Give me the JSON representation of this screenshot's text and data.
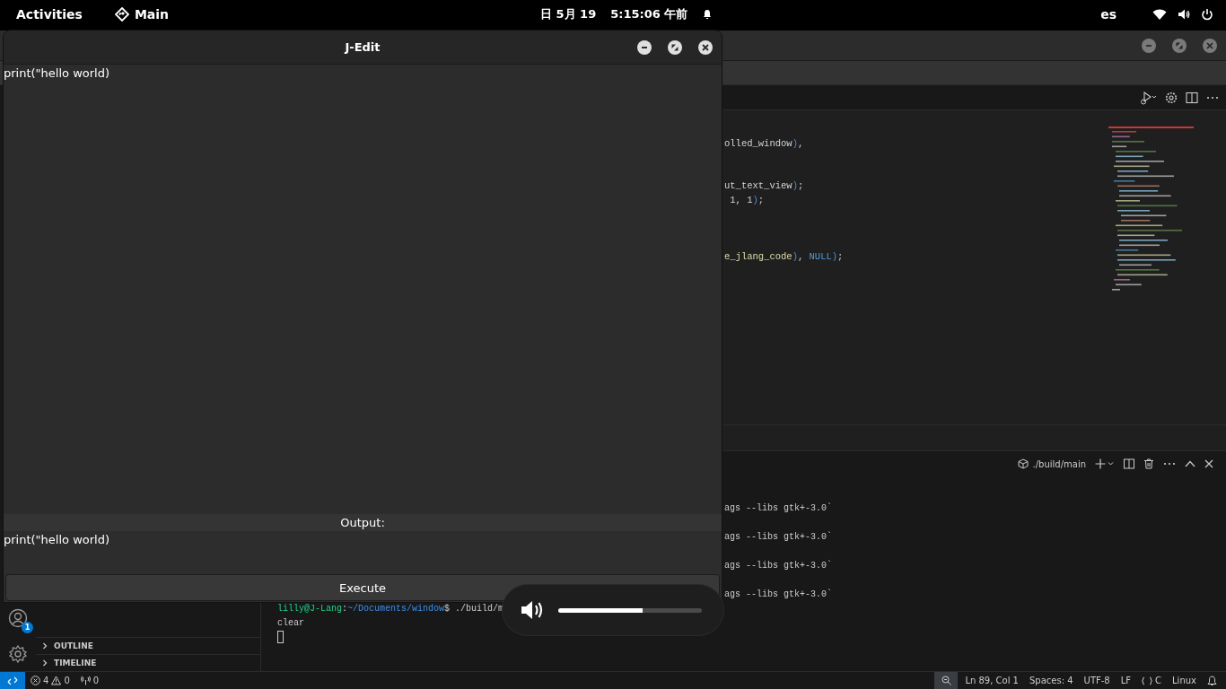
{
  "top_bar": {
    "activities": "Activities",
    "app_menu": "Main",
    "date": "日 5月 19",
    "time": "5:15:06 午前",
    "input_source": "es"
  },
  "vscode": {
    "code_lines": [
      {
        "kind": "code",
        "tokens": [
          {
            "text": "olled_window",
            "kind": "ident"
          },
          {
            "text": ")",
            "kind": "paren"
          },
          {
            "text": ",",
            "kind": "punct"
          }
        ]
      },
      {
        "kind": "blank"
      },
      {
        "kind": "blank"
      },
      {
        "kind": "code",
        "tokens": [
          {
            "text": "ut_text_view",
            "kind": "ident"
          },
          {
            "text": ")",
            "kind": "paren"
          },
          {
            "text": ";",
            "kind": "punct"
          }
        ]
      },
      {
        "kind": "code",
        "tokens": [
          {
            "text": " 1, 1",
            "kind": "ident"
          },
          {
            "text": ")",
            "kind": "paren"
          },
          {
            "text": ";",
            "kind": "punct"
          }
        ]
      },
      {
        "kind": "blank"
      },
      {
        "kind": "blank"
      },
      {
        "kind": "blank"
      },
      {
        "kind": "code",
        "tokens": [
          {
            "text": "e_jlang_code",
            "kind": "func"
          },
          {
            "text": ")",
            "kind": "paren"
          },
          {
            "text": ", ",
            "kind": "punct"
          },
          {
            "text": "NULL",
            "kind": "const"
          },
          {
            "text": ")",
            "kind": "paren"
          },
          {
            "text": ";",
            "kind": "punct"
          }
        ]
      }
    ],
    "terminal_tab": "./build/main",
    "terminal_lines": [
      {
        "kind": "blank"
      },
      {
        "kind": "tail",
        "text": "ags --libs gtk+-3.0`"
      },
      {
        "kind": "blank"
      },
      {
        "kind": "tail",
        "text": "ags --libs gtk+-3.0`"
      },
      {
        "kind": "blank"
      },
      {
        "kind": "tail",
        "text": "ags --libs gtk+-3.0`"
      },
      {
        "kind": "blank"
      },
      {
        "kind": "tail",
        "text": "ags --libs gtk+-3.0`"
      },
      {
        "kind": "prompt",
        "user": "lilly@J-Lang",
        "separator": ":",
        "path": "~/Documents/window",
        "command": "$ ./build/m"
      },
      {
        "kind": "plain",
        "text": "clear"
      },
      {
        "kind": "cursor"
      }
    ],
    "account_badge": "1",
    "sidebar_sections": [
      {
        "label": "OUTLINE",
        "expanded": false
      },
      {
        "label": "TIMELINE",
        "expanded": false
      }
    ],
    "status_bar": {
      "errors": "4",
      "warnings": "0",
      "ports": "0",
      "items": [
        {
          "kind": "text",
          "text": "Ln 89, Col 1"
        },
        {
          "kind": "text",
          "text": "Spaces: 4"
        },
        {
          "kind": "text",
          "text": "UTF-8"
        },
        {
          "kind": "text",
          "text": "LF"
        },
        {
          "kind": "language",
          "text": "C"
        },
        {
          "kind": "text",
          "text": "Linux"
        }
      ]
    }
  },
  "jedit": {
    "title": "J-Edit",
    "input": "print(\"hello world)",
    "output_label": "Output:",
    "output": "print(\"hello world)",
    "execute": "Execute"
  },
  "volume_osd": {
    "level": 0.59
  }
}
